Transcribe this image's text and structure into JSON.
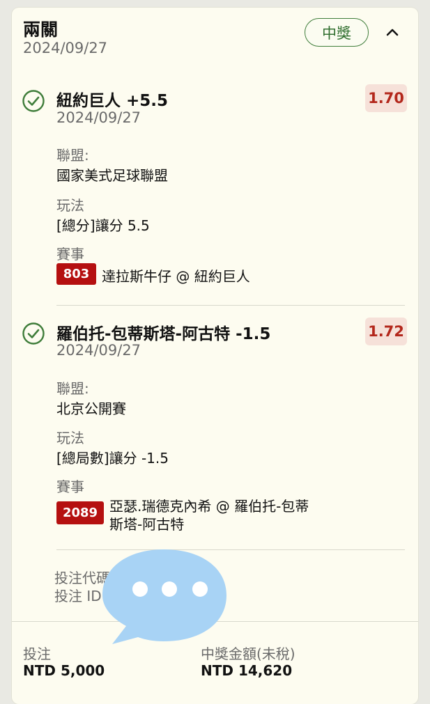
{
  "header": {
    "title": "兩關",
    "date": "2024/09/27",
    "status": "中獎"
  },
  "selections": [
    {
      "title": "紐約巨人 +5.5",
      "date": "2024/09/27",
      "odds": "1.70",
      "league_label": "聯盟:",
      "league": "國家美式足球聯盟",
      "market_label": "玩法",
      "market": "[總分]讓分 5.5",
      "event_label": "賽事",
      "event_code": "803",
      "event_name": "達拉斯牛仔 @ 紐約巨人"
    },
    {
      "title": "羅伯托-包蒂斯塔-阿古特 -1.5",
      "date": "2024/09/27",
      "odds": "1.72",
      "league_label": "聯盟:",
      "league": "北京公開賽",
      "market_label": "玩法",
      "market": "[總局數]讓分 -1.5",
      "event_label": "賽事",
      "event_code": "2089",
      "event_name_line1": "亞瑟.瑞德克內希 @ 羅伯托-包蒂",
      "event_name_line2": "斯塔-阿古特"
    }
  ],
  "bet_info": {
    "code_label": "投注代碼",
    "id_label": "投注 ID:"
  },
  "footer": {
    "stake_label": "投注",
    "stake_value": "NTD 5,000",
    "payout_label": "中獎金額(未稅)",
    "payout_value": "NTD 14,620"
  },
  "colors": {
    "card_background": "#fdfcf0",
    "win_green": "#3f7d3a",
    "odds_red": "#b3271b",
    "odds_background": "#f6e1d9",
    "event_badge_red": "#b51010",
    "overlay_blue": "#a8d3f5"
  },
  "icons": {
    "win_check": "check-circle-icon",
    "collapse": "chevron-up-icon",
    "overlay": "chat-bubble-icon"
  }
}
